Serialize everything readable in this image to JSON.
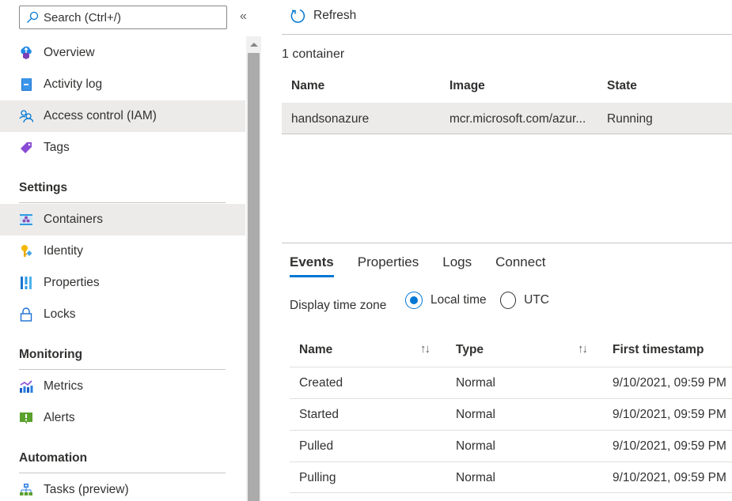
{
  "sidebar": {
    "search_placeholder": "Search (Ctrl+/)",
    "collapse_icon": "«",
    "items": [
      {
        "label": "Overview",
        "icon": "overview-icon"
      },
      {
        "label": "Activity log",
        "icon": "activity-log-icon"
      },
      {
        "label": "Access control (IAM)",
        "icon": "iam-icon"
      },
      {
        "label": "Tags",
        "icon": "tag-icon"
      }
    ],
    "sections": [
      {
        "title": "Settings",
        "items": [
          {
            "label": "Containers",
            "icon": "containers-icon",
            "active": true
          },
          {
            "label": "Identity",
            "icon": "identity-icon"
          },
          {
            "label": "Properties",
            "icon": "properties-icon"
          },
          {
            "label": "Locks",
            "icon": "lock-icon"
          }
        ]
      },
      {
        "title": "Monitoring",
        "items": [
          {
            "label": "Metrics",
            "icon": "metrics-icon"
          },
          {
            "label": "Alerts",
            "icon": "alerts-icon"
          }
        ]
      },
      {
        "title": "Automation",
        "items": [
          {
            "label": "Tasks (preview)",
            "icon": "tasks-icon"
          }
        ]
      }
    ]
  },
  "toolbar": {
    "refresh_label": "Refresh"
  },
  "containers": {
    "count_label": "1 container",
    "columns": [
      "Name",
      "Image",
      "State"
    ],
    "rows": [
      {
        "name": "handsonazure",
        "image": "mcr.microsoft.com/azur...",
        "state": "Running"
      }
    ]
  },
  "details": {
    "tabs": [
      {
        "label": "Events",
        "active": true
      },
      {
        "label": "Properties"
      },
      {
        "label": "Logs"
      },
      {
        "label": "Connect"
      }
    ],
    "timezone": {
      "label": "Display time zone",
      "options": [
        {
          "label": "Local time",
          "checked": true
        },
        {
          "label": "UTC",
          "checked": false
        }
      ]
    },
    "events": {
      "columns": [
        "Name",
        "Type",
        "First timestamp"
      ],
      "sort_glyph": "↑↓",
      "rows": [
        {
          "name": "Created",
          "type": "Normal",
          "first_timestamp": "9/10/2021, 09:59 PM"
        },
        {
          "name": "Started",
          "type": "Normal",
          "first_timestamp": "9/10/2021, 09:59 PM"
        },
        {
          "name": "Pulled",
          "type": "Normal",
          "first_timestamp": "9/10/2021, 09:59 PM"
        },
        {
          "name": "Pulling",
          "type": "Normal",
          "first_timestamp": "9/10/2021, 09:59 PM"
        }
      ]
    }
  },
  "colors": {
    "accent": "#0078d4",
    "selected_bg": "#edebe9"
  }
}
